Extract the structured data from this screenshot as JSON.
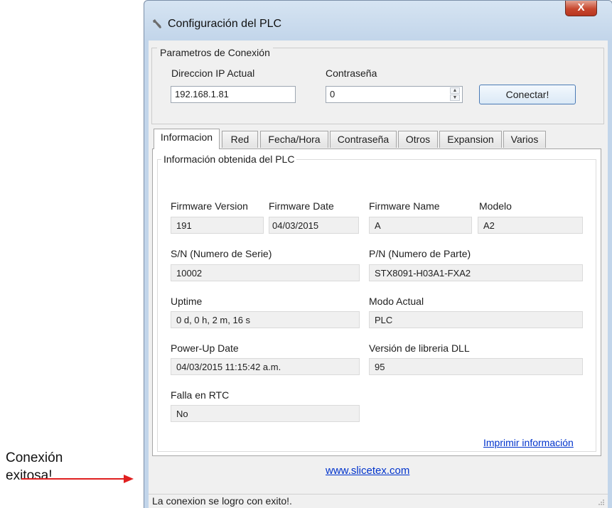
{
  "annotation": {
    "line1": "Conexión",
    "line2": "exitosa!"
  },
  "window": {
    "title": "Configuración del PLC",
    "close_label": "X"
  },
  "connection": {
    "group_title": "Parametros de Conexión",
    "ip_label": "Direccion IP Actual",
    "ip_value": "192.168.1.81",
    "password_label": "Contraseña",
    "password_value": "0",
    "connect_label": "Conectar!"
  },
  "tabs": [
    {
      "label": "Informacion",
      "active": true
    },
    {
      "label": "Red"
    },
    {
      "label": "Fecha/Hora"
    },
    {
      "label": "Contraseña"
    },
    {
      "label": "Otros"
    },
    {
      "label": "Expansion"
    },
    {
      "label": "Varios"
    }
  ],
  "info": {
    "group_title": "Información obtenida del PLC",
    "firmware_version": {
      "label": "Firmware Version",
      "value": "191"
    },
    "firmware_date": {
      "label": "Firmware Date",
      "value": "04/03/2015"
    },
    "firmware_name": {
      "label": "Firmware Name",
      "value": "A"
    },
    "modelo": {
      "label": "Modelo",
      "value": "A2"
    },
    "serial": {
      "label": "S/N (Numero de Serie)",
      "value": "10002"
    },
    "part": {
      "label": "P/N (Numero de Parte)",
      "value": "STX8091-H03A1-FXA2"
    },
    "uptime": {
      "label": "Uptime",
      "value": "0 d, 0 h, 2 m, 16 s"
    },
    "mode": {
      "label": "Modo Actual",
      "value": "PLC"
    },
    "powerup": {
      "label": "Power-Up Date",
      "value": "04/03/2015 11:15:42 a.m."
    },
    "dll": {
      "label": "Versión de libreria DLL",
      "value": "95"
    },
    "rtc": {
      "label": "Falla en RTC",
      "value": "No"
    },
    "print_link": "Imprimir información"
  },
  "footer_link": "www.slicetex.com",
  "status": {
    "text": "La conexion se logro con exito!."
  },
  "colors": {
    "arrow": "#e02020",
    "link": "#0033cc",
    "close_button": "#c7472e"
  }
}
